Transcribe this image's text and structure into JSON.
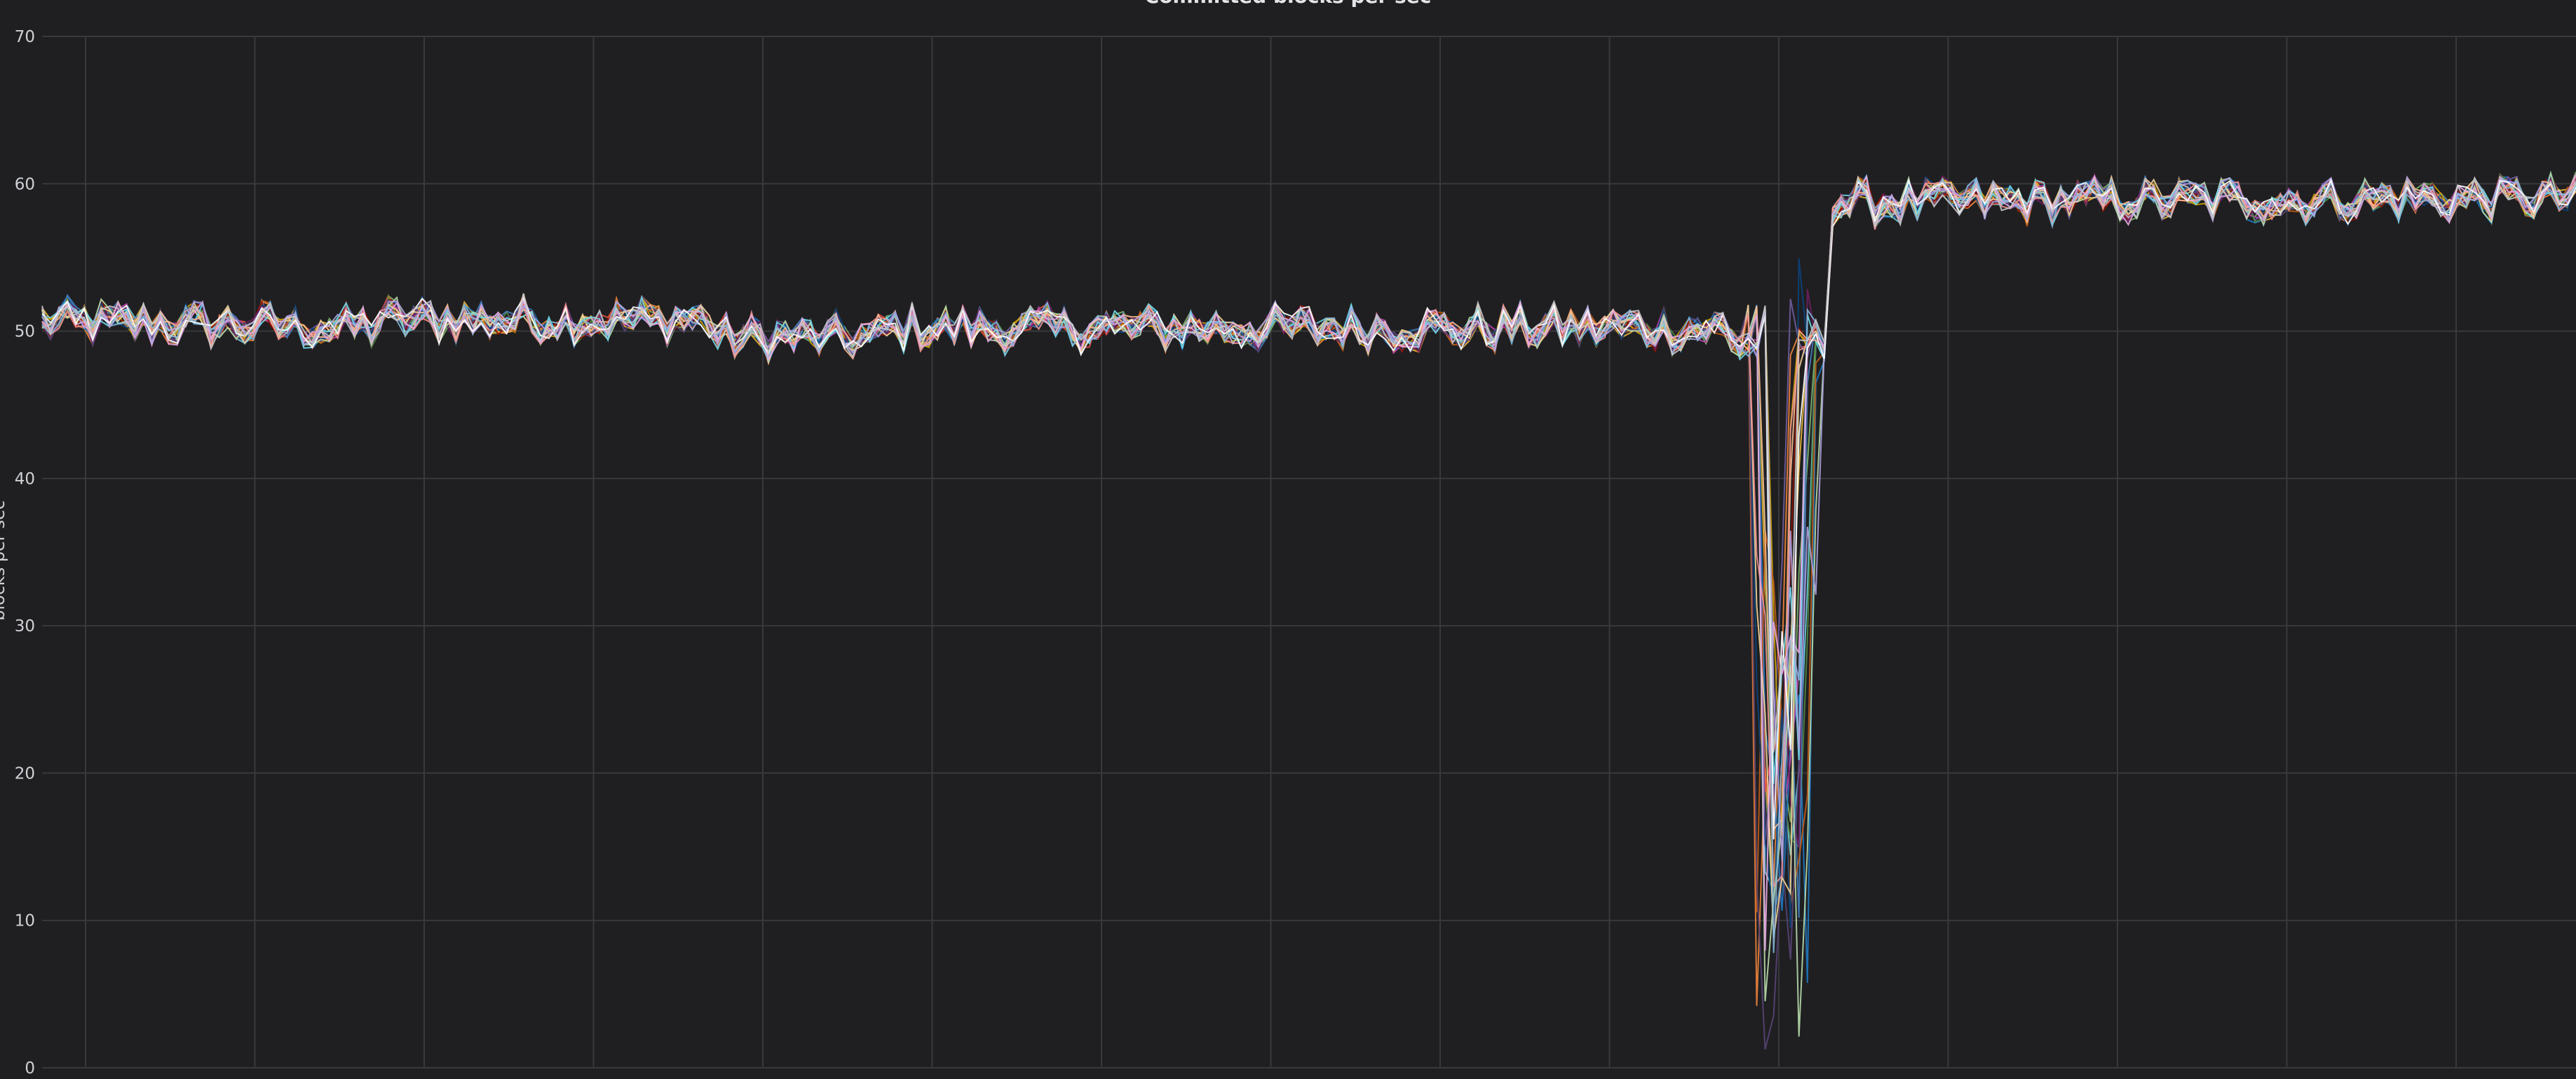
{
  "chart_data": {
    "type": "line",
    "title": "Committed blocks per sec",
    "ylabel": "blocks per sec",
    "xlabel": "",
    "ylim": [
      0,
      70
    ],
    "yticks": [
      0,
      10,
      20,
      30,
      40,
      50,
      60,
      70
    ],
    "grid": true,
    "legend": "none",
    "palette": [
      "#7eb26d",
      "#eab839",
      "#6ed0e0",
      "#ef843c",
      "#e24d42",
      "#1f78c1",
      "#ba43a9",
      "#705da0",
      "#508642",
      "#cca300",
      "#447ebc",
      "#c15c17",
      "#890f02",
      "#0a437c",
      "#6d1f62",
      "#584477",
      "#b7dbab",
      "#f4d598",
      "#70dbed",
      "#f9ba8f",
      "#f29191",
      "#82b5d8",
      "#e5a8e2",
      "#aea2e0",
      "#ffffff",
      "#c8c8c8"
    ],
    "x": [
      0,
      1,
      2,
      3,
      4,
      5,
      6,
      7,
      8,
      9,
      10,
      11,
      12,
      13,
      14,
      15,
      16,
      17,
      18,
      19,
      20,
      21,
      22,
      23,
      24,
      25,
      26,
      27,
      28,
      29,
      30,
      31,
      32,
      33,
      34,
      35,
      36,
      37,
      38,
      39,
      40,
      41,
      42,
      43,
      44,
      45,
      46,
      47,
      48,
      49,
      50,
      51,
      52,
      53,
      54,
      55,
      56,
      57,
      58,
      59,
      60,
      61,
      62,
      63,
      64,
      65,
      66,
      67,
      68,
      69,
      70,
      71,
      72,
      73,
      74,
      75,
      76,
      77,
      78,
      79,
      80,
      81,
      82,
      83,
      84,
      85,
      86,
      87,
      88,
      89,
      90,
      91,
      92,
      93,
      94,
      95,
      96,
      97,
      98,
      99,
      100,
      101,
      102,
      103,
      104,
      105,
      106,
      107,
      108,
      109,
      110,
      111,
      112,
      113,
      114,
      115,
      116,
      117,
      118,
      119,
      120,
      121,
      122,
      123,
      124,
      125,
      126,
      127,
      128,
      129,
      130,
      131,
      132,
      133,
      134,
      135,
      136,
      137,
      138,
      139,
      140,
      141,
      142,
      143,
      144,
      145,
      146,
      147,
      148,
      149,
      150,
      151,
      152,
      153,
      154,
      155,
      156,
      157,
      158,
      159,
      160,
      161,
      162,
      163,
      164,
      165,
      166,
      167,
      168,
      169,
      170,
      171,
      172,
      173,
      174,
      175,
      176,
      177,
      178,
      179,
      180,
      181,
      182,
      183,
      184,
      185,
      186,
      187,
      188,
      189,
      190,
      191,
      192,
      193,
      194,
      195,
      196,
      197,
      198,
      199,
      200,
      201,
      202,
      203,
      204,
      205,
      206,
      207,
      208,
      209,
      210,
      211,
      212,
      213,
      214,
      215,
      216,
      217,
      218,
      219,
      220,
      221,
      222,
      223,
      224,
      225,
      226,
      227,
      228,
      229,
      230,
      231,
      232,
      233,
      234,
      235,
      236,
      237,
      238,
      239,
      240,
      241,
      242,
      243,
      244,
      245,
      246,
      247,
      248,
      249,
      250,
      251,
      252,
      253,
      254,
      255,
      256,
      257,
      258,
      259,
      260,
      261,
      262,
      263,
      264,
      265,
      266,
      267,
      268,
      269,
      270,
      271,
      272,
      273,
      274,
      275,
      276,
      277,
      278,
      279,
      280,
      281,
      282,
      283,
      284,
      285,
      286,
      287,
      288,
      289,
      290,
      291,
      292,
      293,
      294,
      295,
      296,
      297,
      298,
      299,
      300
    ],
    "series_count": 26
  }
}
